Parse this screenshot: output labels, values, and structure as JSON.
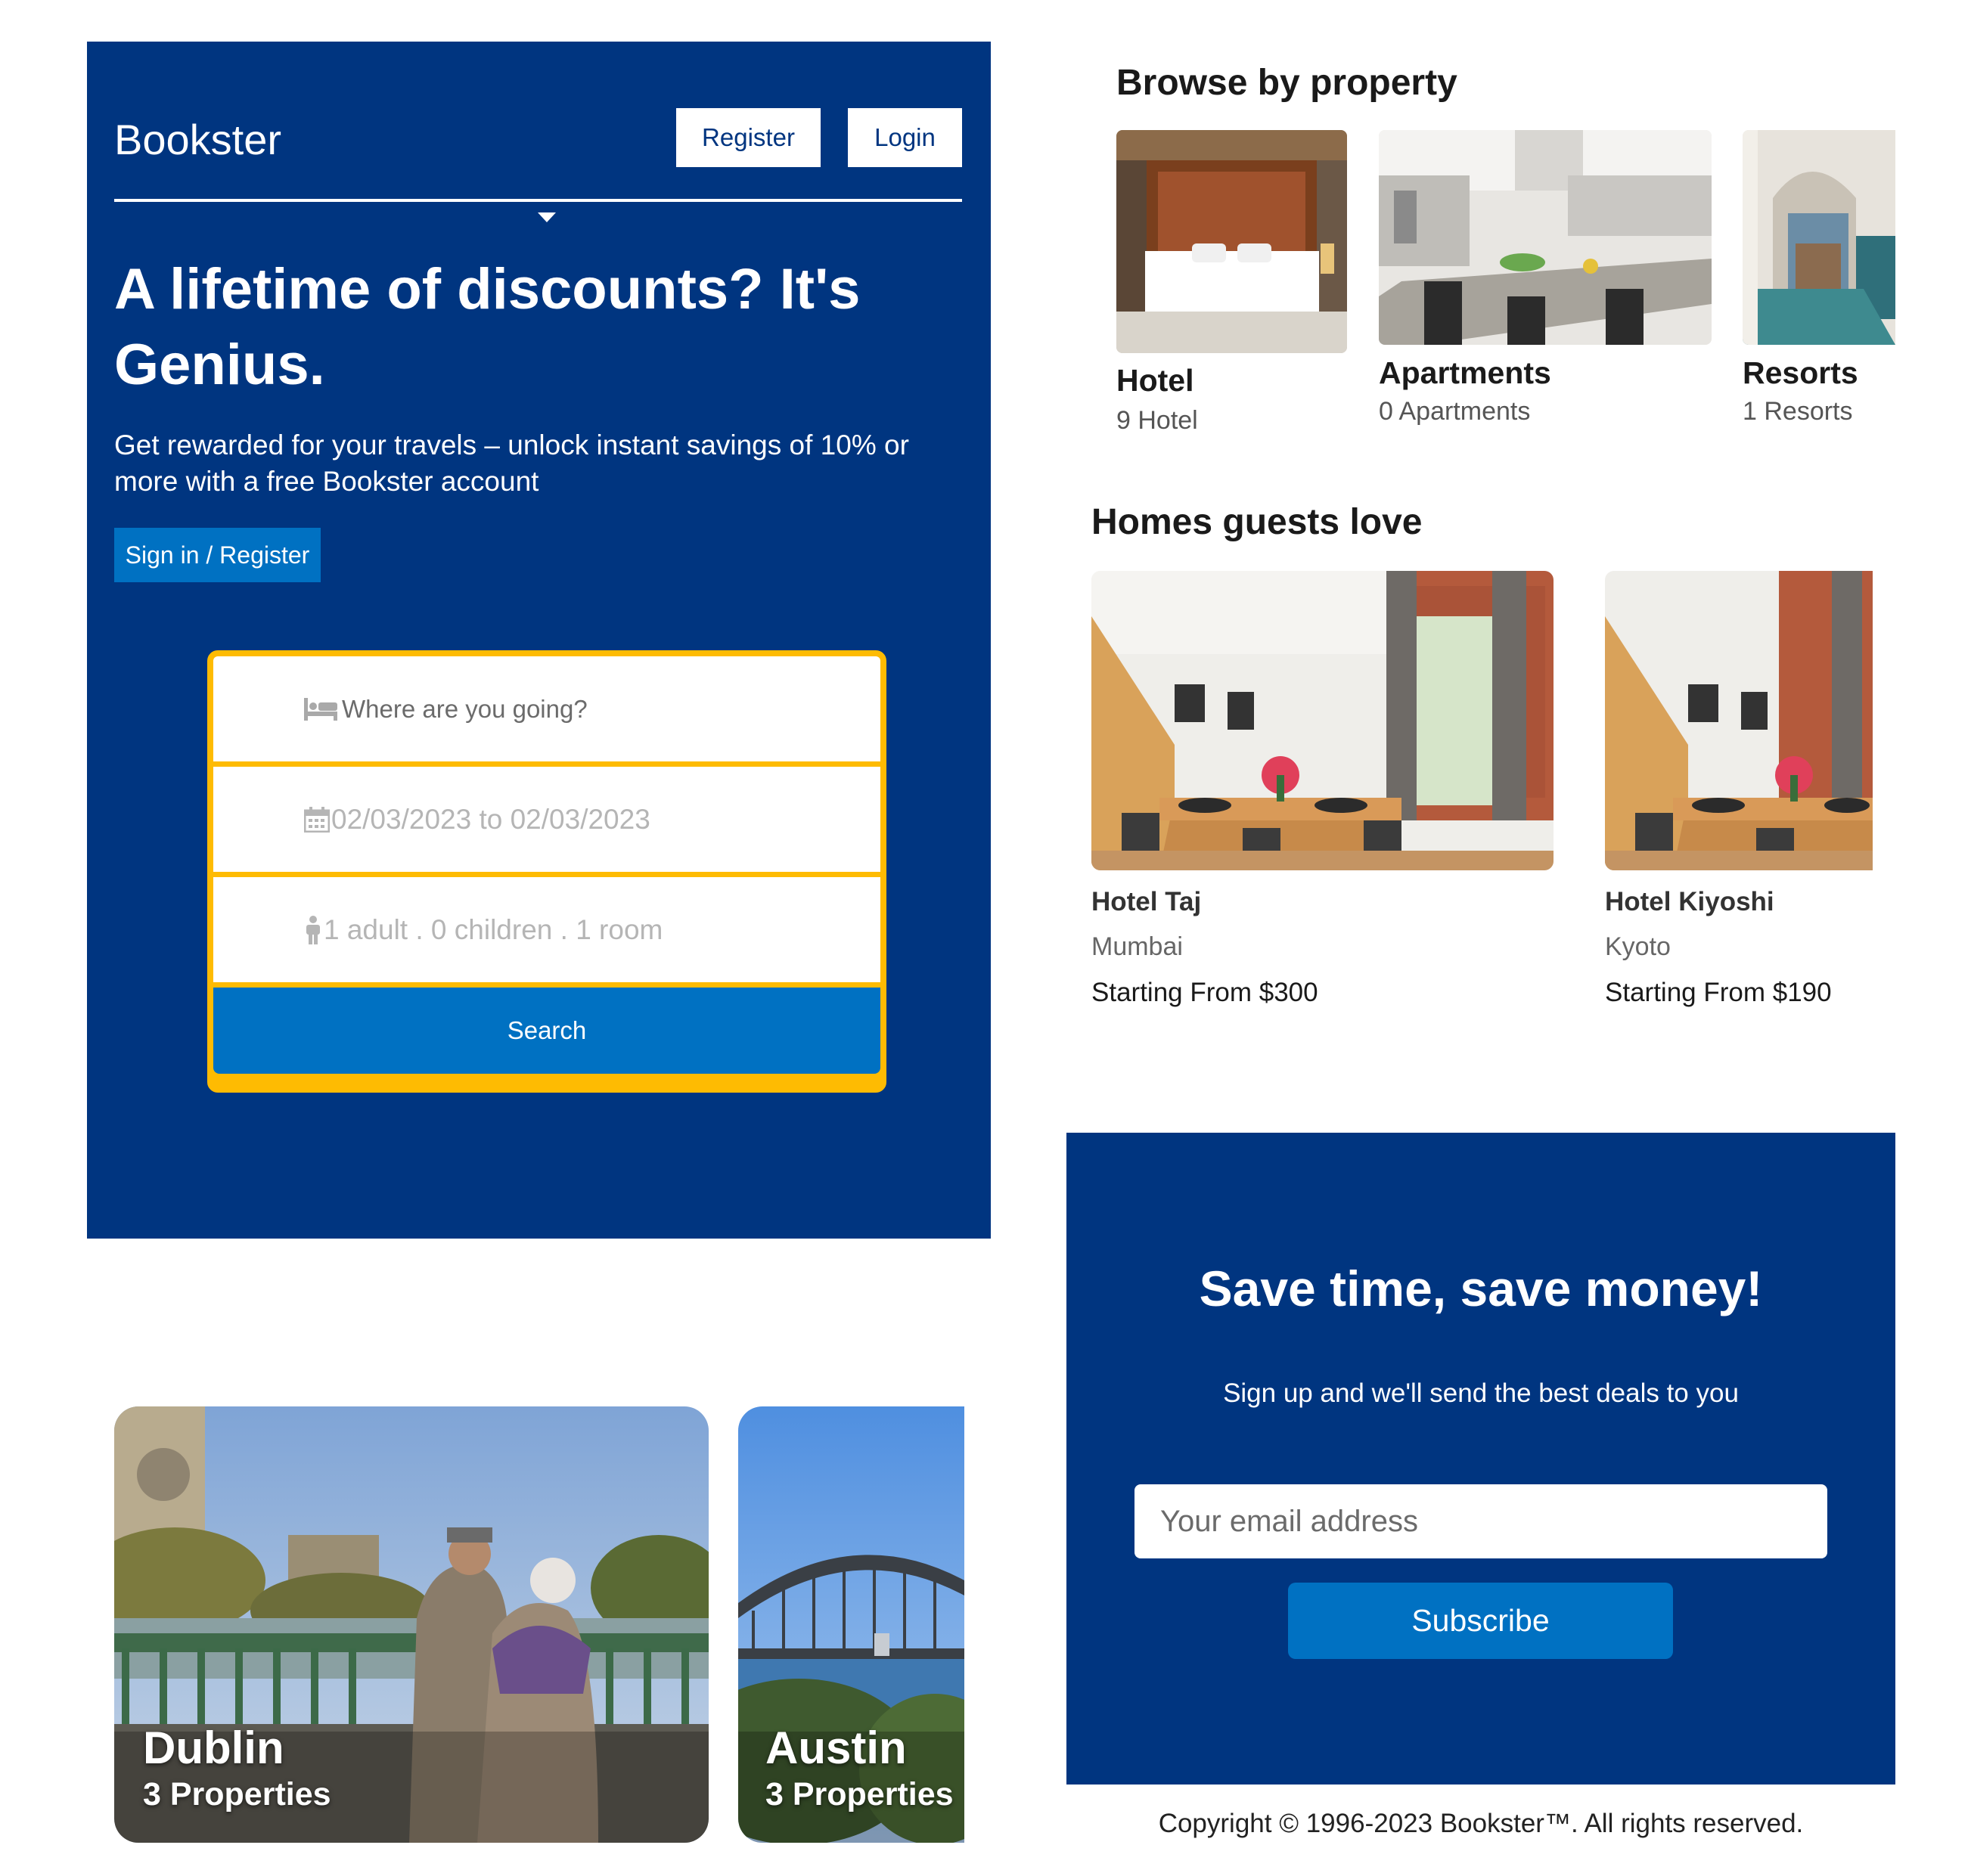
{
  "header": {
    "brand": "Bookster",
    "register_label": "Register",
    "login_label": "Login"
  },
  "hero": {
    "title": "A lifetime of discounts? It's Genius.",
    "subtitle": "Get rewarded for your travels – unlock instant savings of 10% or more with a free Bookster account",
    "signin_label": "Sign in / Register"
  },
  "search": {
    "destination_placeholder": "Where are you going?",
    "dates": "02/03/2023 to 02/03/2023",
    "guests": "1 adult . 0 children . 1 room",
    "button_label": "Search"
  },
  "browse": {
    "title": "Browse by property",
    "items": [
      {
        "name": "Hotel",
        "count": "9 Hotel"
      },
      {
        "name": "Apartments",
        "count": "0 Apartments"
      },
      {
        "name": "Resorts",
        "count": "1 Resorts"
      }
    ]
  },
  "homes": {
    "title": "Homes guests love",
    "items": [
      {
        "name": "Hotel Taj",
        "city": "Mumbai",
        "price": "Starting From $300"
      },
      {
        "name": "Hotel Kiyoshi",
        "city": "Kyoto",
        "price": "Starting From $190"
      }
    ]
  },
  "cities": [
    {
      "name": "Dublin",
      "properties": "3 Properties"
    },
    {
      "name": "Austin",
      "properties": "3 Properties"
    }
  ],
  "newsletter": {
    "title": "Save time, save money!",
    "subtitle": "Sign up and we'll send the best deals to you",
    "email_placeholder": "Your email address",
    "subscribe_label": "Subscribe"
  },
  "footer": {
    "copyright": "Copyright © 1996-2023 Bookster™. All rights reserved."
  },
  "icons": {
    "destination": "bed-icon",
    "dates": "calendar-icon",
    "guests": "person-icon",
    "header_caret": "caret-down-icon"
  },
  "colors": {
    "primary_dark": "#003580",
    "primary": "#0071c2",
    "accent": "#febb02"
  }
}
